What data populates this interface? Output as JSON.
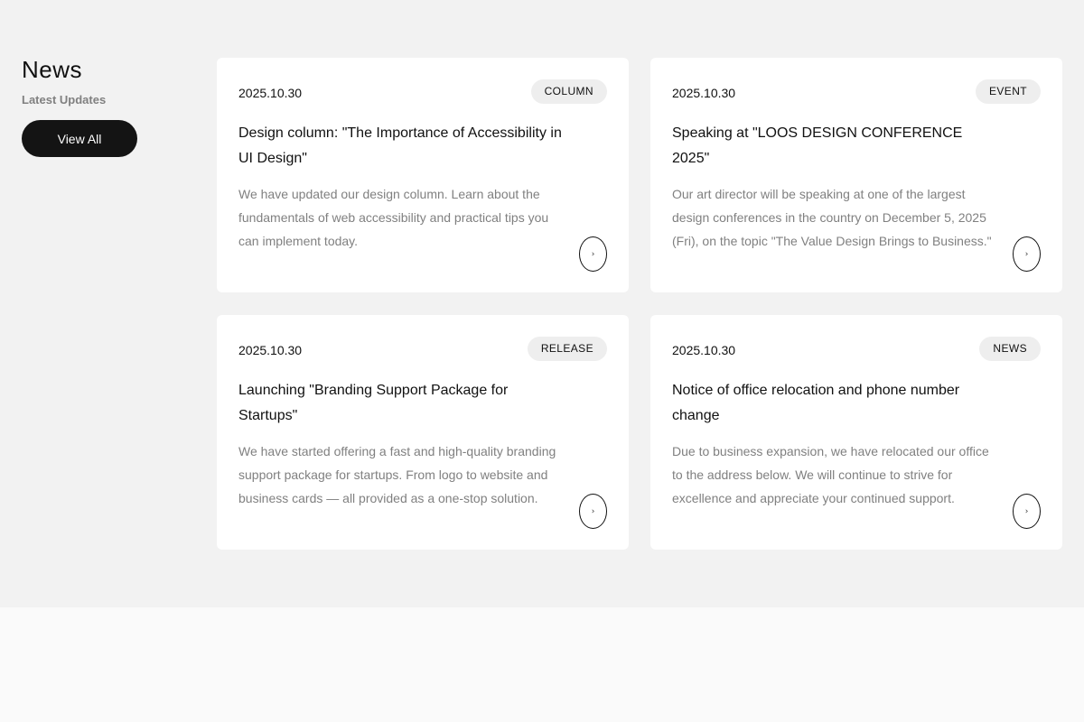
{
  "news": {
    "heading": "News",
    "subheading": "Latest Updates",
    "view_all_label": "View All",
    "cards": [
      {
        "date": "2025.10.30",
        "tag": "COLUMN",
        "title": "Design column: \"The Importance of Accessibility in UI Design\"",
        "text": "We have updated our design column. Learn about the fundamentals of web accessibility and practical tips you can implement today.",
        "arrow": "›"
      },
      {
        "date": "2025.10.30",
        "tag": "EVENT",
        "title": "Speaking at \"LOOS DESIGN CONFERENCE 2025\"",
        "text": "Our art director will be speaking at one of the largest design conferences in the country on December 5, 2025 (Fri), on the topic \"The Value Design Brings to Business.\"",
        "arrow": "›"
      },
      {
        "date": "2025.10.30",
        "tag": "RELEASE",
        "title": "Launching \"Branding Support Package for Startups\"",
        "text": "We have started offering a fast and high-quality branding support package for startups. From logo to website and business cards — all provided as a one-stop solution.",
        "arrow": "›"
      },
      {
        "date": "2025.10.30",
        "tag": "NEWS",
        "title": "Notice of office relocation and phone number change",
        "text": "Due to business expansion, we have relocated our office to the address below. We will continue to strive for excellence and appreciate your continued support.",
        "arrow": "›"
      }
    ]
  },
  "colors": {
    "section_bg": "#f2f2f2",
    "card_bg": "#ffffff",
    "button_bg": "#141414",
    "muted_text": "#808080",
    "tag_bg": "#eeeeee"
  }
}
